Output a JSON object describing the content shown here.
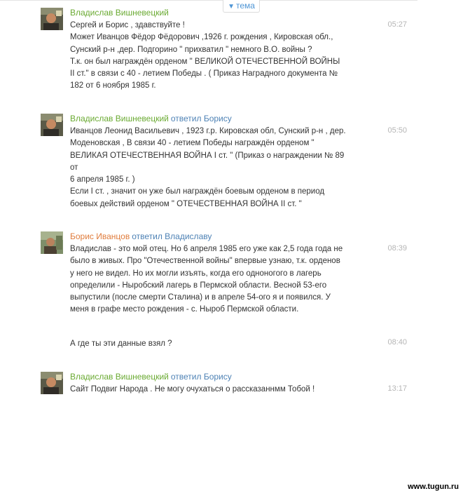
{
  "topic_tab": {
    "label": "тема",
    "arrow": "▼"
  },
  "messages": [
    {
      "author": "Владислав Вишневецкий",
      "reply": "",
      "time": "05:27",
      "lines": [
        "Сергей и Борис  , здавствуйте !",
        "Может Иванцов Фёдор Фёдорович ,1926 г. рождения , Кировская обл.,",
        "Сунский р-н ,дер. Подгорино \" прихватил \" немного В.О. войны ?",
        "Т.к. он был награждён орденом \"  ВЕЛИКОЙ ОТЕЧЕСТВЕННОЙ ВОЙНЫ",
        "II ст.\" в связи с 40 - летием Победы . ( Приказ Наградного документа №",
        "182 от 6 ноября 1985 г."
      ]
    },
    {
      "author": "Владислав Вишневецкий",
      "reply": "ответил Борису",
      "time": "05:50",
      "lines": [
        "Иванцов Леонид Васильевич , 1923 г.р. Кировская обл, Сунский р-н , дер.",
        "Моденовская   , В связи 40 - летием Победы награждён орденом  \"",
        "ВЕЛИКАЯ ОТЕЧЕСТВЕННАЯ ВОЙНА I ст. \" (Приказ о награждении № 89",
        "от",
        "6 апреля 1985 г. )",
        "Если  I ст. , значит он уже был награждён боевым орденом в период",
        "боевых действий орденом  \"  ОТЕЧЕСТВЕННАЯ ВОЙНА  II ст. \""
      ]
    },
    {
      "author": "Борис Иванцов",
      "reply": "ответил Владиславу",
      "time": "08:39",
      "lines": [
        "Владислав - это мой отец. Но 6 апреля 1985 его уже как 2,5 года  года не",
        "было в живых.  Про \"Отечественной войны\" впервые узнаю, т.к. орденов",
        "у него не видел. Но их могли изъять, когда его одноногого в лагерь",
        "определили - Ныробский лагерь в Пермской области. Весной 53-его",
        "выпустили (после смерти Сталина) и в апреле 54-ого я и появился. У",
        "меня в графе место рождения - с. Ныроб Пермской области."
      ]
    },
    {
      "author": "",
      "reply": "",
      "time": "08:40",
      "lines": [
        "А где ты эти данные взял ?"
      ]
    },
    {
      "author": "Владислав Вишневецкий",
      "reply": "ответил Борису",
      "time": "13:17",
      "lines": [
        "Сайт  Подвиг Народа .   Не могу очухаться о рассказаннмм Тобой !"
      ]
    }
  ],
  "watermark": "www.tugun.ru",
  "colors": {
    "author_green": "#6aaa32",
    "author_orange": "#e07c3c",
    "reply_blue": "#4e82b5",
    "time_gray": "#b5b5b5"
  },
  "icons": [
    "user-avatar-photo",
    "chevron-down-icon"
  ]
}
